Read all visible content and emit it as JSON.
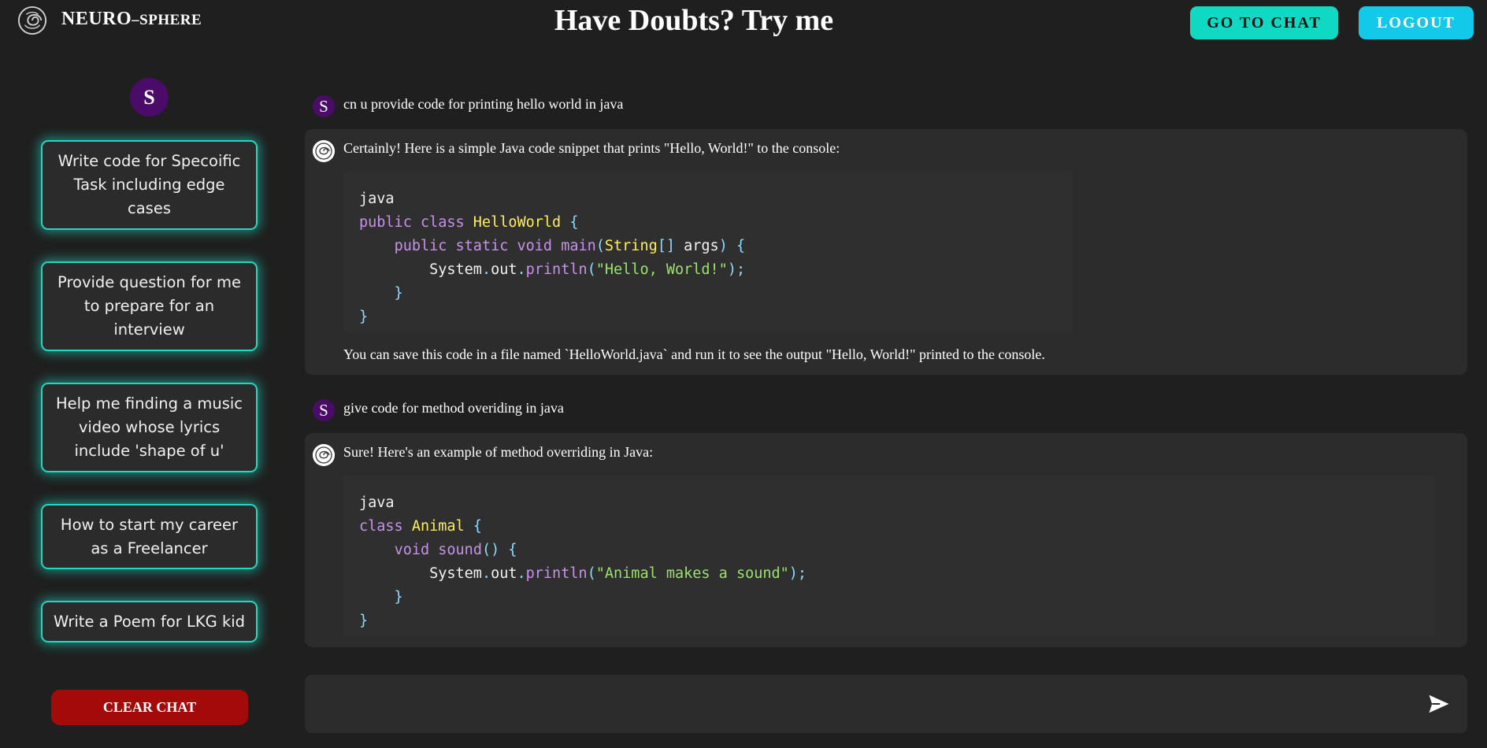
{
  "header": {
    "brand_main": "NEURO",
    "brand_sub": "–SPHERE",
    "title": "Have Doubts? Try me",
    "go_to_chat": "GO TO CHAT",
    "logout": "LOGOUT"
  },
  "sidebar": {
    "avatar_letter": "S",
    "suggestions": [
      "Write code for Specoific Task including edge cases",
      "Provide question for me to prepare for an interview",
      "Help me finding a music video whose lyrics include 'shape of u'",
      "How to start my career as a Freelancer",
      "Write a Poem for LKG kid"
    ],
    "clear_chat": "CLEAR CHAT"
  },
  "chat": {
    "messages": [
      {
        "role": "user",
        "avatar": "S",
        "text": "cn u provide code for printing hello world in java"
      },
      {
        "role": "bot",
        "intro": "Certainly! Here is a simple Java code snippet that prints \"Hello, World!\" to the console:",
        "code_lang": "java",
        "code_lines": [
          "public class HelloWorld {",
          "    public static void main(String[] args) {",
          "        System.out.println(\"Hello, World!\");",
          "    }",
          "}"
        ],
        "outro": "You can save this code in a file named `HelloWorld.java` and run it to see the output \"Hello, World!\" printed to the console."
      },
      {
        "role": "user",
        "avatar": "S",
        "text": "give code for method overiding in java"
      },
      {
        "role": "bot",
        "intro": "Sure! Here's an example of method overriding in Java:",
        "code_lang": "java",
        "code_lines": [
          "class Animal {",
          "    void sound() {",
          "        System.out.println(\"Animal makes a sound\");",
          "    }",
          "}"
        ]
      }
    ]
  },
  "input": {
    "placeholder": "",
    "value": ""
  },
  "colors": {
    "background": "#1f1f1f",
    "accent_teal": "#10d9c3",
    "accent_cyan": "#12c9ea",
    "avatar_purple": "#4b0b69",
    "danger_red": "#a30a0a"
  },
  "icons": {
    "logo": "spiral-logo-icon",
    "bot": "bot-logo-icon",
    "send": "send-icon"
  }
}
